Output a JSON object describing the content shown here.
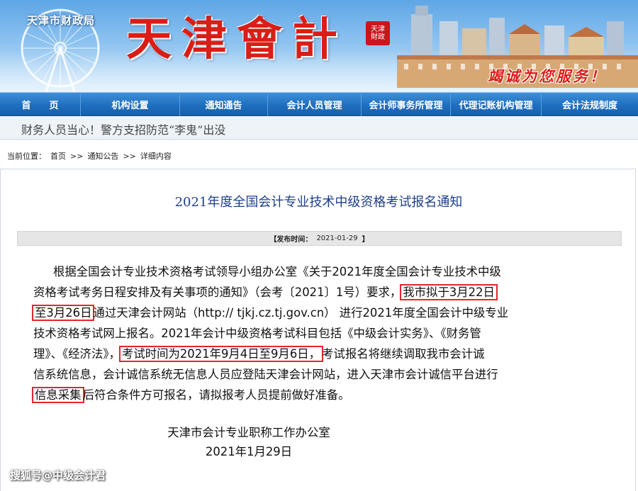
{
  "banner": {
    "department": "天津市财政局",
    "calligraphy_title": "天津會計",
    "seal_text": "天津財政",
    "slogan": "竭诚为您服务！"
  },
  "nav": {
    "items": [
      {
        "label": "首　　页"
      },
      {
        "label": "机构设置"
      },
      {
        "label": "通知通告"
      },
      {
        "label": "会计人员管理"
      },
      {
        "label": "会计师事务所管理"
      },
      {
        "label": "代理记账机构管理"
      },
      {
        "label": "会计法规制度"
      }
    ]
  },
  "marquee": {
    "text": "财务人员当心！警方支招防范“李鬼”出没"
  },
  "breadcrumb": {
    "prefix": "当前位置：",
    "items": [
      "首页",
      "通知公告",
      "详细内容"
    ],
    "separator": ">>"
  },
  "article": {
    "title": "2021年度全国会计专业技术中级资格考试报名通知",
    "publish_label": "【发布时间：",
    "publish_date": "2021-01-29",
    "publish_close": "】",
    "lines": {
      "l1": "根据全国会计专业技术资格考试领导小组办公室《关于2021年度全国会计专业技术中级",
      "l2_a": "资格考试考务日程安排及有关事项的通知》（会考〔2021〕1号）要求，",
      "l2_hl": "我市拟于3月22日",
      "l3_hl": "至3月26日",
      "l3_b": "通过天津会计网站（http:// tjkj.cz.tj.gov.cn） 进行2021年度全国会计中级专业",
      "l4": "技术资格考试网上报名。2021年会计中级资格考试科目包括《中级会计实务》、《财务管",
      "l5_a": "理》、《经济法》，",
      "l5_hl": "考试时间为2021年9月4日至9月6日，",
      "l5_b": "考试报名将继续调取我市会计诚",
      "l6": "信系统信息，会计诚信系统无信息人员应登陆天津会计网站，进入天津市会计诚信平台进行",
      "l7_hl": "信息采集",
      "l7_b": "后符合条件方可报名，请拟报考人员提前做好准备。"
    },
    "signature_org": "天津市会计专业职称工作办公室",
    "signature_date": "2021年1月29日"
  },
  "watermark": "搜狐号@中级会计君",
  "colors": {
    "nav_blue": "#1f6fc0",
    "title_blue": "#1e3f8a",
    "highlight_red": "#e3262b",
    "brand_red": "#d91e18"
  }
}
